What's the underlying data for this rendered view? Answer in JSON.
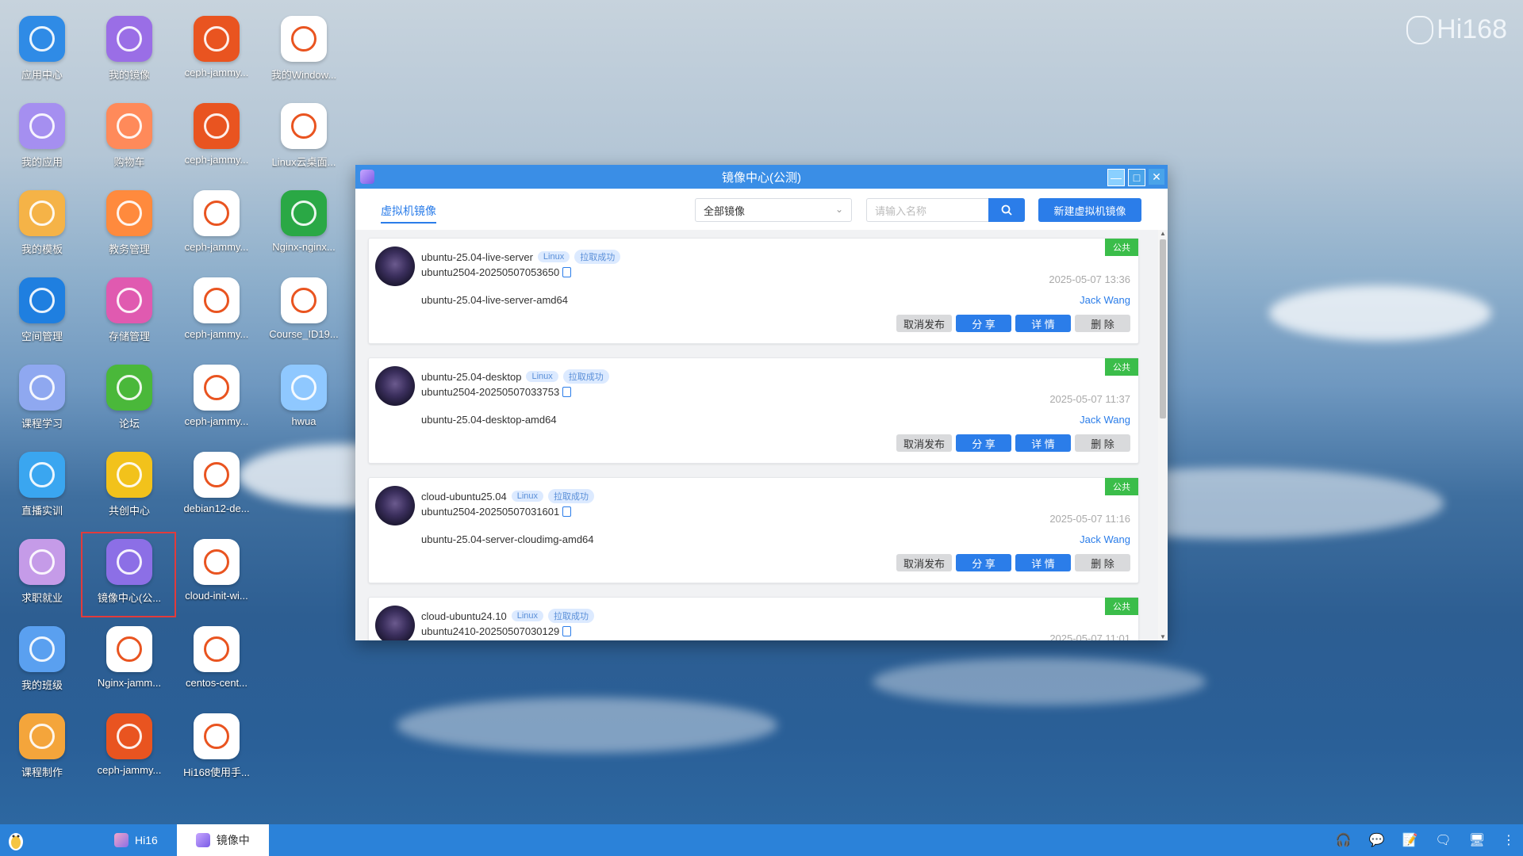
{
  "brand": {
    "text": "Hi168"
  },
  "desktop_icons": [
    {
      "label": "应用中心",
      "icon": "app-center-icon",
      "color": "#2f8be6"
    },
    {
      "label": "我的应用",
      "icon": "my-apps-icon",
      "color": "#a58ff0"
    },
    {
      "label": "我的模板",
      "icon": "folder-icon",
      "color": "#f5b347"
    },
    {
      "label": "空间管理",
      "icon": "space-manage-icon",
      "color": "#1f7fe0"
    },
    {
      "label": "课程学习",
      "icon": "course-icon",
      "color": "#8fa8f0"
    },
    {
      "label": "直播实训",
      "icon": "live-play-icon",
      "color": "#3aa6f0"
    },
    {
      "label": "求职就业",
      "icon": "job-icon",
      "color": "#c59be8"
    },
    {
      "label": "我的班级",
      "icon": "class-icon",
      "color": "#5aa0f0"
    },
    {
      "label": "课程制作",
      "icon": "course-make-icon",
      "color": "#f4a53b"
    },
    {
      "label": "我的镜像",
      "icon": "my-image-icon",
      "color": "#9a6ee6"
    },
    {
      "label": "购物车",
      "icon": "cart-icon",
      "color": "#ff8a5a"
    },
    {
      "label": "教务管理",
      "icon": "academic-icon",
      "color": "#ff8a3d"
    },
    {
      "label": "存储管理",
      "icon": "storage-icon",
      "color": "#e05ab0"
    },
    {
      "label": "论坛",
      "icon": "forum-icon",
      "color": "#4ab83a"
    },
    {
      "label": "共创中心",
      "icon": "cocreate-icon",
      "color": "#f2c21b"
    },
    {
      "label": "镜像中心(公...",
      "icon": "image-center-icon",
      "color": "#8c6fe6"
    },
    {
      "label": "Nginx-jamm...",
      "icon": "ubuntu-icon",
      "color": "#ffffff"
    },
    {
      "label": "ceph-jammy...",
      "icon": "ubuntu-icon",
      "color": "#e95420"
    },
    {
      "label": "ceph-jammy...",
      "icon": "ubuntu-icon",
      "color": "#e95420"
    },
    {
      "label": "ceph-jammy...",
      "icon": "ubuntu-icon",
      "color": "#e95420"
    },
    {
      "label": "ceph-jammy...",
      "icon": "ceph-icon",
      "color": "#ffffff"
    },
    {
      "label": "ceph-jammy...",
      "icon": "ceph-icon",
      "color": "#ffffff"
    },
    {
      "label": "ceph-jammy...",
      "icon": "ceph-icon",
      "color": "#ffffff"
    },
    {
      "label": "debian12-de...",
      "icon": "debian-icon",
      "color": "#ffffff"
    },
    {
      "label": "cloud-init-wi...",
      "icon": "windows-icon",
      "color": "#ffffff"
    },
    {
      "label": "centos-cent...",
      "icon": "centos-icon",
      "color": "#ffffff"
    },
    {
      "label": "Hi168使用手...",
      "icon": "manual-icon",
      "color": "#ffffff"
    },
    {
      "label": "我的Window...",
      "icon": "windows-icon",
      "color": "#ffffff"
    },
    {
      "label": "Linux云桌面...",
      "icon": "linux-icon",
      "color": "#ffffff"
    },
    {
      "label": "Nginx-nginx...",
      "icon": "nginx-icon",
      "color": "#2aa845"
    },
    {
      "label": "Course_ID19...",
      "icon": "linux-icon",
      "color": "#ffffff"
    },
    {
      "label": "hwua",
      "icon": "hwua-icon",
      "color": "#8fc8ff"
    }
  ],
  "window": {
    "title": "镜像中心(公测)",
    "tab": "虚拟机镜像",
    "filter_selected": "全部镜像",
    "search_placeholder": "请输入名称",
    "new_button": "新建虚拟机镜像",
    "cards": [
      {
        "name": "ubuntu-25.04-live-server",
        "os_tag": "Linux",
        "status_tag": "拉取成功",
        "image_id": "ubuntu2504-20250507053650",
        "desc": "ubuntu-25.04-live-server-amd64",
        "public": "公共",
        "date": "2025-05-07 13:36",
        "owner": "Jack Wang"
      },
      {
        "name": "ubuntu-25.04-desktop",
        "os_tag": "Linux",
        "status_tag": "拉取成功",
        "image_id": "ubuntu2504-20250507033753",
        "desc": "ubuntu-25.04-desktop-amd64",
        "public": "公共",
        "date": "2025-05-07 11:37",
        "owner": "Jack Wang"
      },
      {
        "name": "cloud-ubuntu25.04",
        "os_tag": "Linux",
        "status_tag": "拉取成功",
        "image_id": "ubuntu2504-20250507031601",
        "desc": "ubuntu-25.04-server-cloudimg-amd64",
        "public": "公共",
        "date": "2025-05-07 11:16",
        "owner": "Jack Wang"
      },
      {
        "name": "cloud-ubuntu24.10",
        "os_tag": "Linux",
        "status_tag": "拉取成功",
        "image_id": "ubuntu2410-20250507030129",
        "desc": "",
        "public": "公共",
        "date": "2025-05-07 11:01",
        "owner": ""
      }
    ],
    "actions": {
      "unpublish": "取消发布",
      "share": "分 享",
      "detail": "详 情",
      "delete": "删 除"
    }
  },
  "taskbar": {
    "items": [
      {
        "label": "Hi16",
        "active": false
      },
      {
        "label": "镜像中",
        "active": true
      }
    ]
  }
}
